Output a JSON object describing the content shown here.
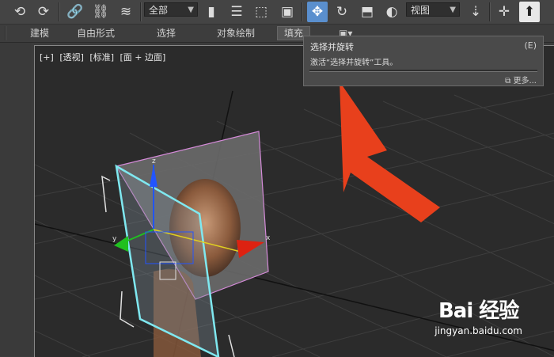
{
  "toolbar": {
    "selection_filter": "全部",
    "reference_coord": "视图",
    "icons": [
      "undo-icon",
      "redo-icon",
      "link-icon",
      "unlink-icon",
      "bind-spacewarp-icon",
      "select-object-icon",
      "select-by-name-icon",
      "rect-selection-icon",
      "window-crossing-icon",
      "move-icon",
      "rotate-icon",
      "scale-icon",
      "placement-icon",
      "pivot-icon",
      "select-manipulate-icon",
      "keyboard-shortcut-icon"
    ]
  },
  "ribbon": {
    "tabs": [
      "建模",
      "自由形式",
      "选择",
      "对象绘制",
      "填充"
    ]
  },
  "viewport": {
    "labels": [
      "[+]",
      "[透视]",
      "[标准]",
      "[面 + 边面]"
    ],
    "gizmo": {
      "x": "x",
      "y": "y",
      "z": "z"
    }
  },
  "tooltip": {
    "title": "选择并旋转",
    "shortcut": "(E)",
    "description": "激活“选择并旋转”工具。",
    "more": "更多..."
  },
  "watermark": {
    "logo": "Bai 经验",
    "url": "jingyan.baidu.com"
  },
  "colors": {
    "active_button": "#5a8fce",
    "arrow": "#e8401c",
    "selection_outline": "#7fe8f0",
    "plane_outline": "#d48ad8"
  }
}
